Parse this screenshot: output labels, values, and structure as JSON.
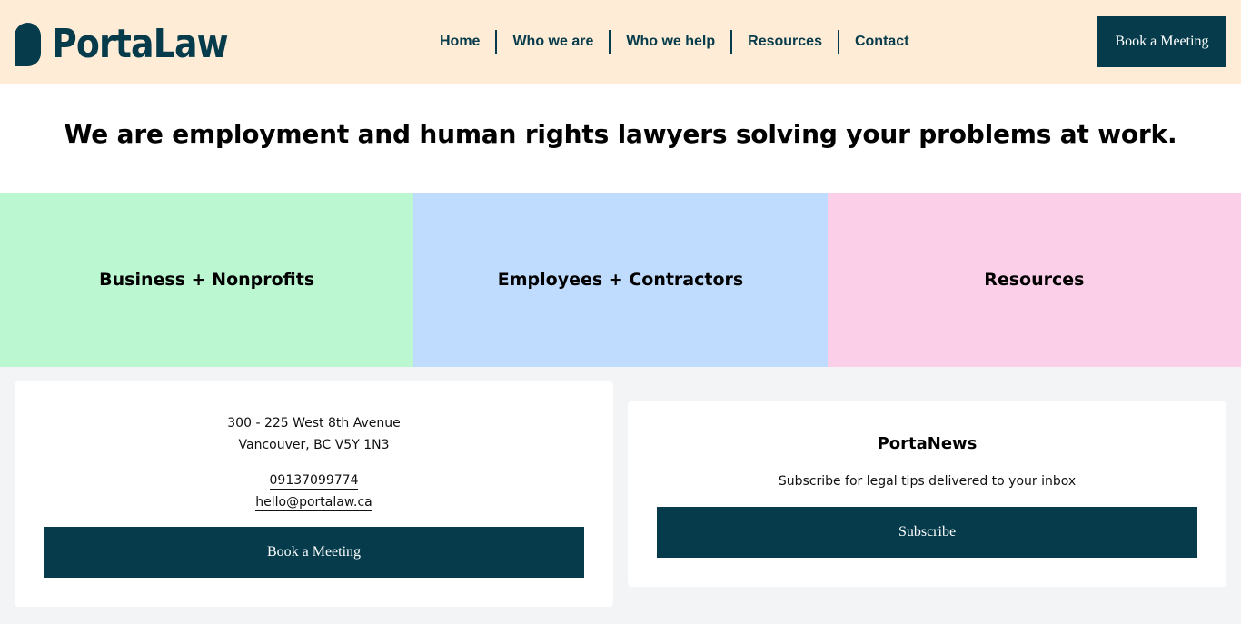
{
  "header": {
    "logo_text": "PortaLaw",
    "nav": [
      {
        "label": "Home"
      },
      {
        "label": "Who we are"
      },
      {
        "label": "Who we help"
      },
      {
        "label": "Resources"
      },
      {
        "label": "Contact"
      }
    ],
    "cta_label": "Book a Meeting"
  },
  "hero": {
    "headline": "We are employment and human rights lawyers solving your problems at work."
  },
  "tiles": [
    {
      "label": "Business + Nonprofits",
      "color": "#bbf7d0"
    },
    {
      "label": "Employees + Contractors",
      "color": "#bfdbfe"
    },
    {
      "label": "Resources",
      "color": "#fbcfe8"
    }
  ],
  "contact": {
    "address_line1": "300 - 225 West 8th Avenue",
    "address_line2": "Vancouver, BC V5Y 1N3",
    "phone": "09137099774",
    "email": "hello@portalaw.ca",
    "button_label": "Book a Meeting"
  },
  "newsletter": {
    "title": "PortaNews",
    "subtitle": "Subscribe for legal tips delivered to your inbox",
    "button_label": "Subscribe"
  },
  "colors": {
    "brand": "#053b4b",
    "header_bg": "#ffecd6",
    "page_bg": "#f3f4f6"
  }
}
